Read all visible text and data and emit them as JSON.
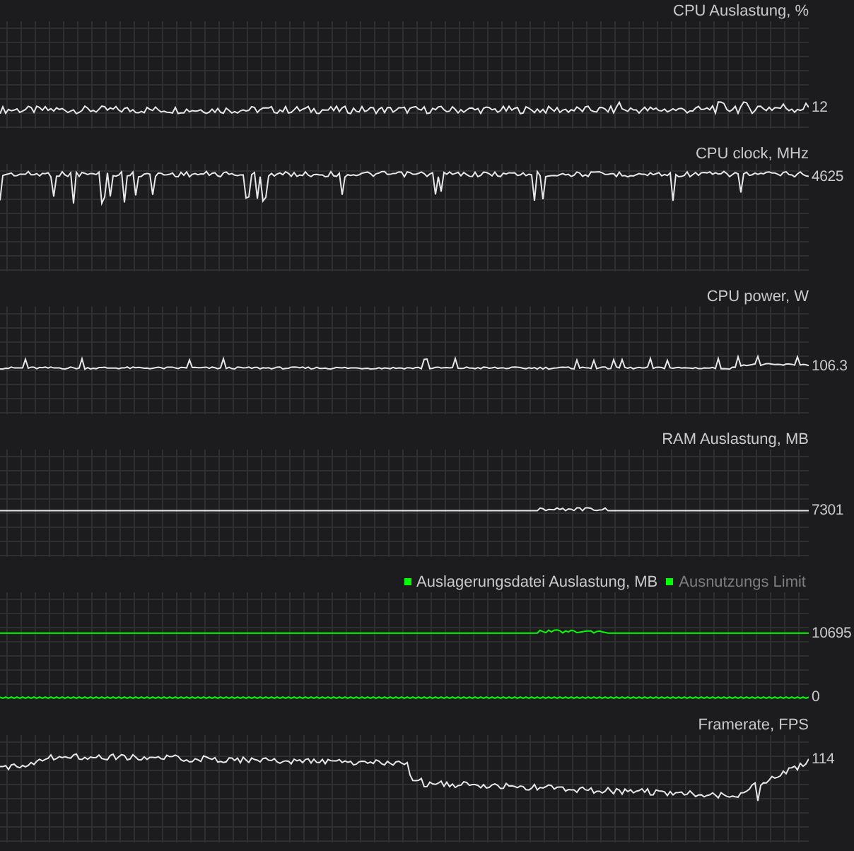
{
  "panels": [
    {
      "title": "CPU Auslastung, %",
      "readings": [
        {
          "value": "12",
          "color": "#e6e6e6",
          "kind": "noise"
        }
      ]
    },
    {
      "title": "CPU clock, MHz",
      "readings": [
        {
          "value": "4625",
          "color": "#e6e6e6",
          "kind": "dips"
        }
      ]
    },
    {
      "title": "CPU power, W",
      "readings": [
        {
          "value": "106.3",
          "color": "#e6e6e6",
          "kind": "steady"
        }
      ]
    },
    {
      "title": "RAM Auslastung, MB",
      "readings": [
        {
          "value": "7301",
          "color": "#e6e6e6",
          "kind": "flat"
        }
      ]
    },
    {
      "legend": [
        {
          "label": "Auslagerungsdatei Auslastung, MB",
          "color": "#00ff00",
          "active": true
        },
        {
          "label": "Ausnutzungs Limit",
          "color": "#00ff00",
          "active": false
        }
      ],
      "readings": [
        {
          "value": "10695",
          "color": "#00ff00",
          "kind": "flat"
        },
        {
          "value": "0",
          "color": "#00ff00",
          "kind": "baseline"
        }
      ]
    },
    {
      "title": "Framerate, FPS",
      "readings": [
        {
          "value": "114",
          "color": "#e6e6e6",
          "kind": "fps"
        }
      ]
    }
  ]
}
